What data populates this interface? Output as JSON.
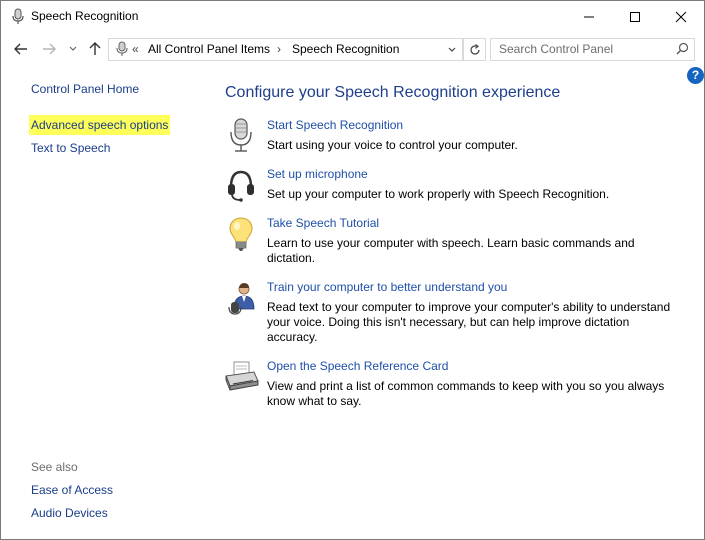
{
  "window": {
    "title": "Speech Recognition"
  },
  "address": {
    "overflow": "«",
    "crumbs": [
      "All Control Panel Items",
      "Speech Recognition"
    ],
    "separator": "›"
  },
  "search": {
    "placeholder": "Search Control Panel"
  },
  "help": "?",
  "sidebar": {
    "home": "Control Panel Home",
    "items": [
      "Advanced speech options",
      "Text to Speech"
    ],
    "highlighted_item_color": "#ffff5a",
    "see_also_label": "See also",
    "see_also": [
      "Ease of Access",
      "Audio Devices"
    ]
  },
  "main": {
    "heading": "Configure your Speech Recognition experience",
    "tasks": [
      {
        "icon": "microphone-icon",
        "link": "Start Speech Recognition",
        "desc": "Start using your voice to control your computer."
      },
      {
        "icon": "headset-icon",
        "link": "Set up microphone",
        "desc": "Set up your computer to work properly with Speech Recognition."
      },
      {
        "icon": "lightbulb-icon",
        "link": "Take Speech Tutorial",
        "desc": "Learn to use your computer with speech.  Learn basic commands and dictation."
      },
      {
        "icon": "user-train-icon",
        "link": "Train your computer to better understand you",
        "desc": "Read text to your computer to improve your computer's ability to understand your voice.  Doing this isn't necessary, but can help improve dictation accuracy."
      },
      {
        "icon": "printer-icon",
        "link": "Open the Speech Reference Card",
        "desc": "View and print a list of common commands to keep with you so you always know what to say."
      }
    ]
  },
  "colors": {
    "link": "#1e4fa8",
    "heading": "#1e3f8c",
    "help": "#1565c0"
  }
}
